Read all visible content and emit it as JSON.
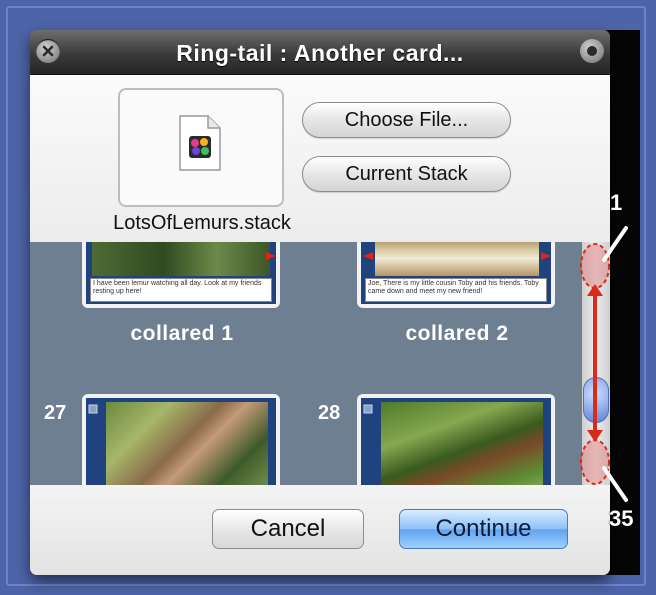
{
  "window": {
    "title": "Ring-tail : Another card..."
  },
  "picker": {
    "file_name": "LotsOfLemurs.stack",
    "choose_file_label": "Choose File...",
    "current_stack_label": "Current Stack"
  },
  "cards": [
    {
      "number": "",
      "label": "collared 1",
      "caption": "I have been lemur watching all day. Look at my friends resting up here!"
    },
    {
      "number": "",
      "label": "collared 2",
      "caption": "Joe, There is my little cousin Toby and his friends. Toby came down and meet my new friend!"
    },
    {
      "number": "27",
      "label": "",
      "caption": ""
    },
    {
      "number": "28",
      "label": "",
      "caption": ""
    }
  ],
  "scroll_annotation": {
    "top_label": "1",
    "bottom_label": "35",
    "position_fraction": 0.5
  },
  "buttons": {
    "cancel": "Cancel",
    "continue": "Continue"
  },
  "colors": {
    "desktop": "#4d64a8",
    "card_background": "#20427f",
    "annotation_red": "#d92a1a",
    "default_button": "#62a4ef"
  },
  "icons": {
    "close": "close-icon",
    "zoom": "zoom-icon",
    "stack_file": "stack-file-icon"
  }
}
